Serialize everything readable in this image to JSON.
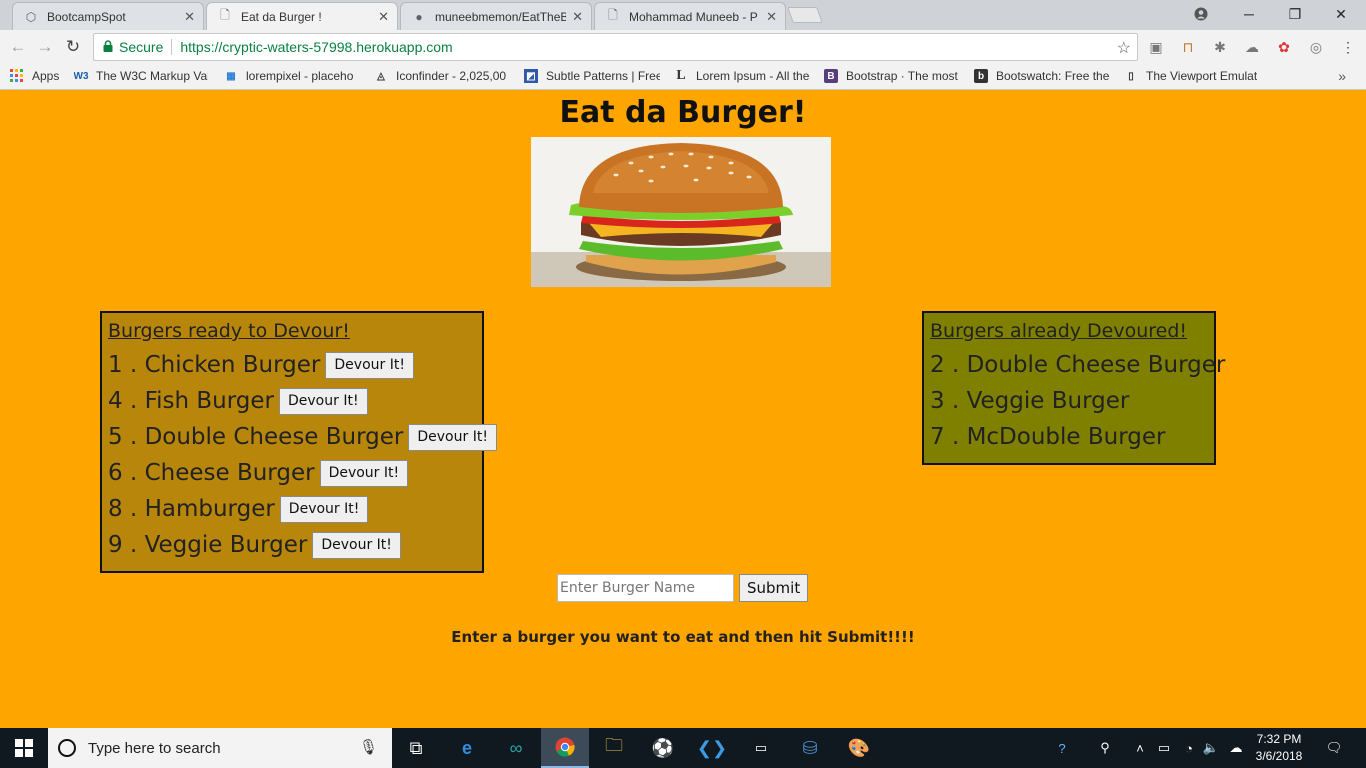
{
  "browser": {
    "tabs": [
      {
        "title": "BootcampSpot",
        "icon": "bootcamp-icon"
      },
      {
        "title": "Eat da Burger !",
        "icon": "page-icon"
      },
      {
        "title": "muneebmemon/EatTheB",
        "icon": "github-icon"
      },
      {
        "title": "Mohammad Muneeb - P",
        "icon": "page-icon"
      }
    ],
    "secure_label": "Secure",
    "url": "https://cryptic-waters-57998.herokuapp.com",
    "bookmarks": [
      {
        "label": "Apps",
        "icon": "apps-grid-icon"
      },
      {
        "label": "The W3C Markup Val",
        "icon": "w3c-icon"
      },
      {
        "label": "lorempixel - placeho",
        "icon": "lorempixel-icon"
      },
      {
        "label": "Iconfinder - 2,025,00",
        "icon": "iconfinder-icon"
      },
      {
        "label": "Subtle Patterns | Free",
        "icon": "subtle-patterns-icon"
      },
      {
        "label": "Lorem Ipsum - All the",
        "icon": "lorem-ipsum-icon"
      },
      {
        "label": "Bootstrap · The most",
        "icon": "bootstrap-icon"
      },
      {
        "label": "Bootswatch: Free the",
        "icon": "bootswatch-icon"
      },
      {
        "label": "The Viewport Emulat",
        "icon": "viewport-icon"
      }
    ]
  },
  "page": {
    "title": "Eat da Burger!",
    "ready": {
      "heading": "Burgers ready to Devour!",
      "button_label": "Devour It!",
      "items": [
        {
          "label": "1 . Chicken Burger"
        },
        {
          "label": "4 . Fish Burger"
        },
        {
          "label": "5 . Double Cheese Burger"
        },
        {
          "label": "6 . Cheese Burger"
        },
        {
          "label": "8 . Hamburger"
        },
        {
          "label": "9 . Veggie Burger"
        }
      ]
    },
    "devoured": {
      "heading": "Burgers already Devoured!",
      "items": [
        {
          "label": "2 . Double Cheese Burger"
        },
        {
          "label": "3 . Veggie Burger"
        },
        {
          "label": "7 . McDouble Burger"
        }
      ]
    },
    "form": {
      "placeholder": "Enter Burger Name",
      "submit_label": "Submit"
    },
    "hint": "Enter a burger you want to eat and then hit Submit!!!!"
  },
  "taskbar": {
    "search_placeholder": "Type here to search",
    "time": "7:32 PM",
    "date": "3/6/2018"
  },
  "colors": {
    "page_background": "#ffa500",
    "ready_panel": "#b8860b",
    "devoured_panel": "#808000",
    "secure_green": "#0b8043"
  }
}
